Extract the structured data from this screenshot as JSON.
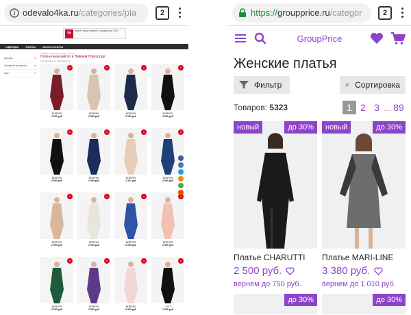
{
  "left": {
    "browser": {
      "url_host": "odevalo4ka.ru",
      "url_path": "/categories/pla",
      "tabs_count": "2"
    },
    "banner": {
      "badge": "%",
      "text": "Купите вещи первой и скидкой до 70%!"
    },
    "nav": [
      "ОДЕЖДА",
      "ОБУВЬ",
      "АКСЕССУАРЫ"
    ],
    "filters": [
      "Бренды",
      "Основной материал",
      "Цвет"
    ],
    "crumbs": "Главная / Женская одежда / Платья",
    "title": "Платья женский по в Нижнем Новгороде",
    "sort": "Сортировать по: Популярности",
    "products": [
      {
        "brand": "BORPES",
        "price": "2 990 руб",
        "color": "#7a1d2b"
      },
      {
        "brand": "BORPES",
        "price": "2 990 руб",
        "color": "#d8c4b1"
      },
      {
        "brand": "BORPES",
        "price": "2 990 руб",
        "color": "#1e2a4a"
      },
      {
        "brand": "BORPES",
        "price": "2 990 руб",
        "color": "#111111"
      },
      {
        "brand": "BORPES",
        "price": "2 990 руб",
        "color": "#111111"
      },
      {
        "brand": "BORPES",
        "price": "2 990 руб",
        "color": "#1b2c5c"
      },
      {
        "brand": "BORPES",
        "price": "1 497 руб",
        "color": "#e6cdb6"
      },
      {
        "brand": "BORPES",
        "price": "2 990 руб",
        "color": "#1f3f7a"
      },
      {
        "brand": "BORPES",
        "price": "2 990 руб",
        "color": "#d9b79b"
      },
      {
        "brand": "BORPES",
        "price": "2 990 руб",
        "color": "#e9e4dc"
      },
      {
        "brand": "BORPES",
        "price": "2 990 руб",
        "color": "#2e53a8"
      },
      {
        "brand": "BORPES",
        "price": "2 990 руб",
        "color": "#f3c1b2"
      },
      {
        "brand": "BORPES",
        "price": "2 990 руб",
        "color": "#1f5a3a"
      },
      {
        "brand": "BORPES",
        "price": "2 990 руб",
        "color": "#5b3a8a"
      },
      {
        "brand": "BORPES",
        "price": "2 990 руб",
        "color": "#f2d6d6"
      },
      {
        "brand": "LOFT",
        "price": "2 990 руб",
        "color": "#111111"
      }
    ]
  },
  "right": {
    "browser": {
      "url_scheme": "https://",
      "url_host": "groupprice.ru",
      "url_path": "/categor",
      "tabs_count": "2"
    },
    "logo": "GroupPrice",
    "heading": "Женские платья",
    "filter_label": "Фильтр",
    "sort_label": "Сортировка",
    "count_label": "Товаров:",
    "count_value": "5323",
    "pages": [
      "1",
      "2",
      "3",
      "...",
      "89"
    ],
    "products": [
      {
        "badge_new": "новый",
        "badge_discount": "до 30%",
        "name": "Платье CHARUTTI",
        "price": "2 500 руб.",
        "cashback": "вернем до 750 руб.",
        "color": "#1a1a1a"
      },
      {
        "badge_new": "новый",
        "badge_discount": "до 30%",
        "name": "Платье MARI-LINE",
        "price": "3 380 руб.",
        "cashback": "вернем до 1 010 руб.",
        "color": "#6d6d6d"
      },
      {
        "badge_discount": "до 30%"
      },
      {
        "badge_discount": "до 30%"
      }
    ],
    "colors": {
      "accent": "#8e44c9",
      "secure": "#1f8b3a"
    }
  }
}
